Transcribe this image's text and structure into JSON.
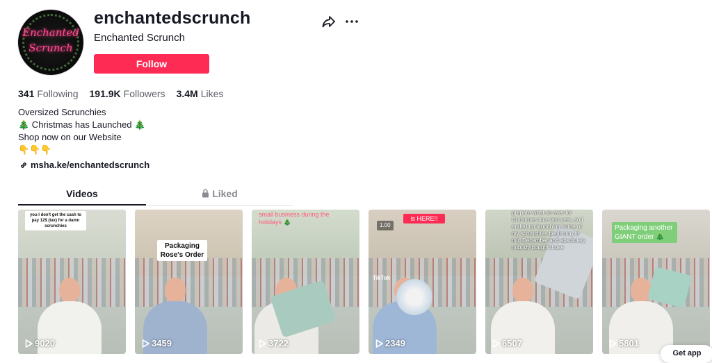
{
  "profile": {
    "username": "enchantedscrunch",
    "nickname": "Enchanted Scrunch",
    "follow_label": "Follow",
    "avatar_text_line1": "Enchanted",
    "avatar_text_line2": "Scrunch"
  },
  "stats": {
    "following_count": "341",
    "following_label": "Following",
    "followers_count": "191.9K",
    "followers_label": "Followers",
    "likes_count": "3.4M",
    "likes_label": "Likes"
  },
  "bio": {
    "line1": "Oversized Scrunchies",
    "line2_prefix": "🎄",
    "line2_text": " Christmas has Launched ",
    "line2_suffix": "🎄",
    "line3": "Shop now on our Website",
    "line4": "👇👇👇"
  },
  "link": {
    "text": "msha.ke/enchantedscrunch"
  },
  "tabs": {
    "videos": "Videos",
    "liked": "Liked"
  },
  "videos": [
    {
      "views": "9020",
      "overlay": "you I don't get the cash to pay 12$ (tax) for a damn scrunchies"
    },
    {
      "views": "3459",
      "overlay": "Packaging Rose's Order"
    },
    {
      "views": "3722",
      "overlay": "small business during the holidays 🎄"
    },
    {
      "views": "2349",
      "overlay": "is HERE!!",
      "badge": "1.00",
      "watermark": "TikTok"
    },
    {
      "views": "6507",
      "overlay": "prepare what so ever for Christmas time last year, so I ended up launching some of my scrunchies beginning to mid December and absolutely nobody bought those"
    },
    {
      "views": "5801",
      "overlay": "Packaging another GIANT order 🎄"
    }
  ],
  "get_app": "Get app",
  "colors": {
    "follow": "#fe2c55",
    "text": "#161823",
    "muted": "#8a8b91"
  }
}
